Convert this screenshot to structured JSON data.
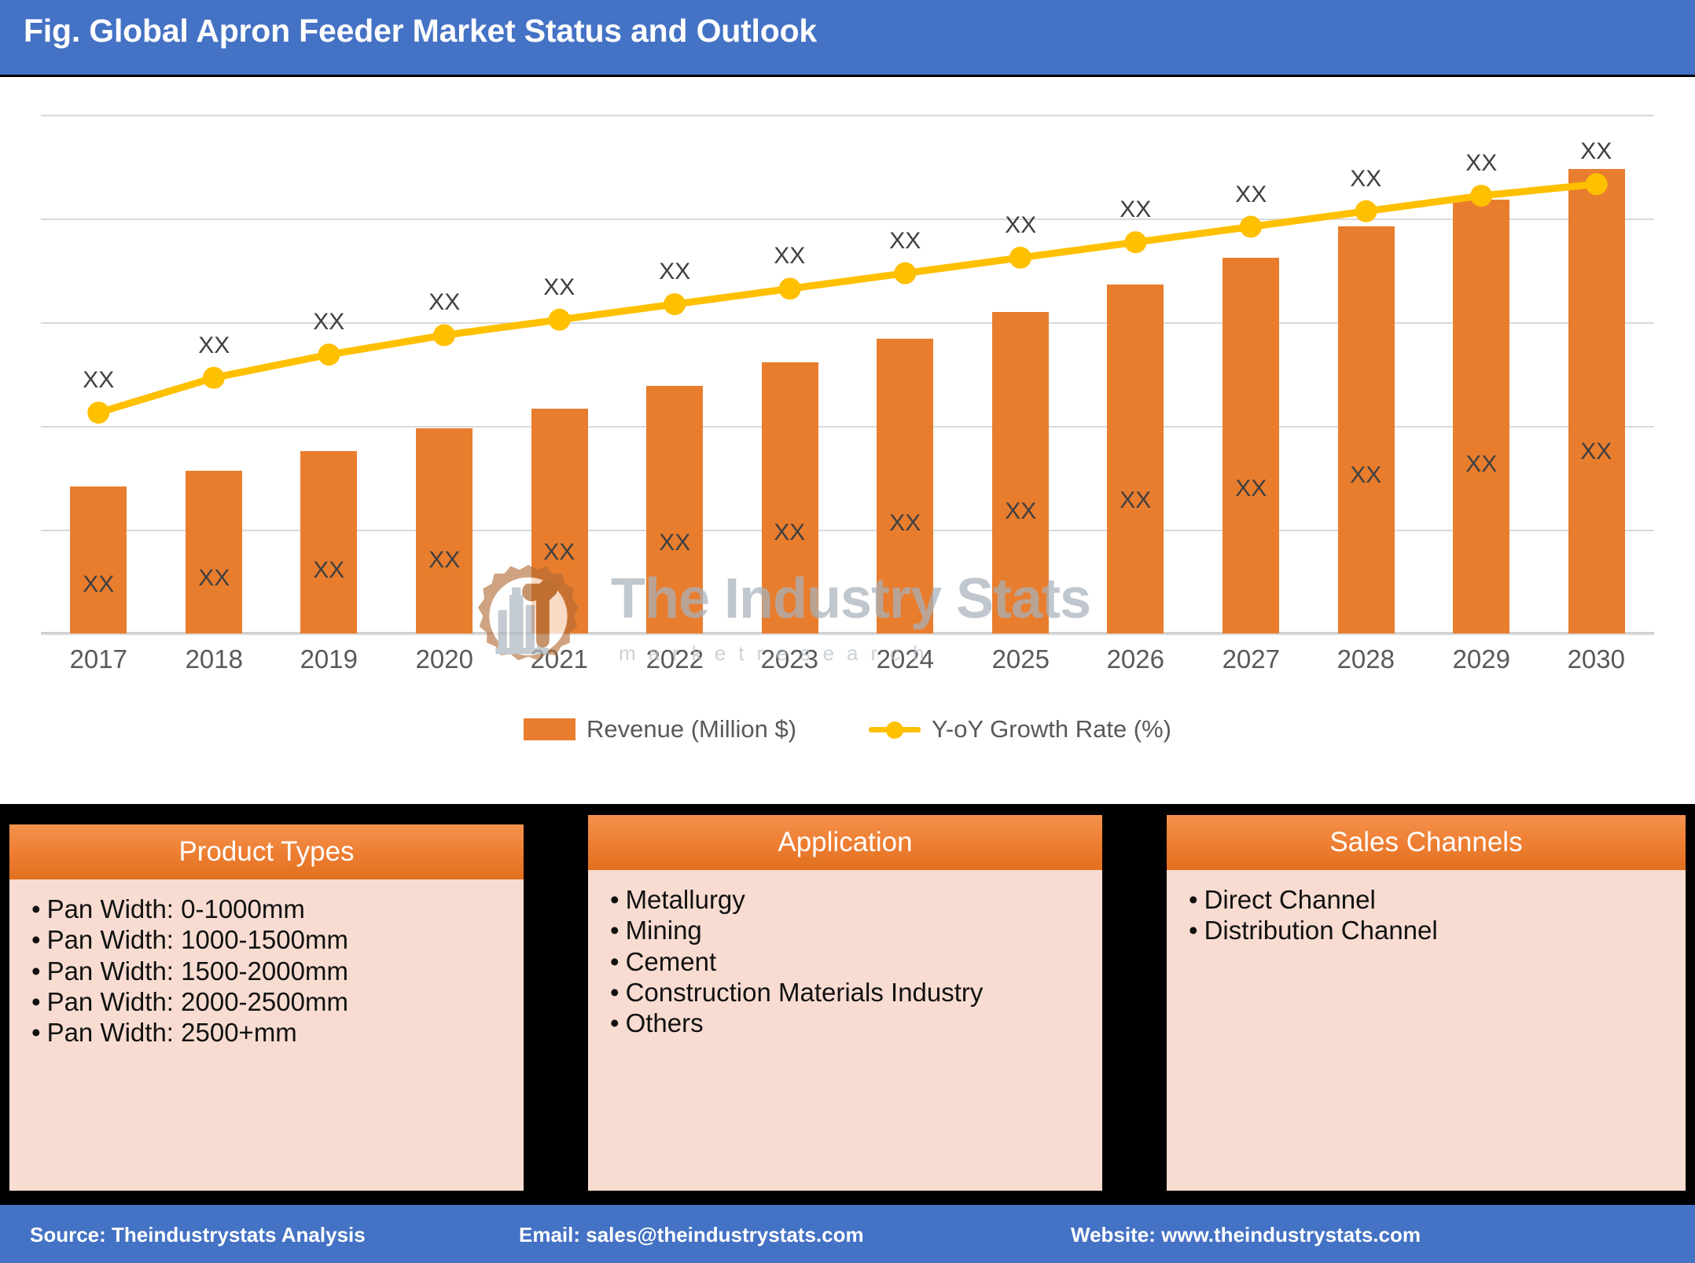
{
  "header": {
    "title": "Fig. Global Apron Feeder Market Status and Outlook",
    "background": "#4472C4"
  },
  "watermark": {
    "brand": "The Industry Stats",
    "tagline": "m a r k e t   r e s e a r c h",
    "logo_icon": "gear-factory-wrench-icon"
  },
  "chart_data": {
    "type": "bar",
    "title": "Global Apron Feeder Market Status and Outlook",
    "xlabel": "",
    "ylabel": "",
    "grid": true,
    "legend_position": "bottom",
    "categories": [
      "2017",
      "2018",
      "2019",
      "2020",
      "2021",
      "2022",
      "2023",
      "2024",
      "2025",
      "2026",
      "2027",
      "2028",
      "2029",
      "2030"
    ],
    "series": [
      {
        "name": "Revenue (Million $)",
        "type": "bar",
        "color": "#E87D2E",
        "axis": "left",
        "value_label": "XX",
        "values": [
          38,
          42,
          47,
          53,
          58,
          64,
          70,
          76,
          83,
          90,
          97,
          105,
          112,
          120
        ],
        "labels": [
          "XX",
          "XX",
          "XX",
          "XX",
          "XX",
          "XX",
          "XX",
          "XX",
          "XX",
          "XX",
          "XX",
          "XX",
          "XX",
          "XX"
        ]
      },
      {
        "name": "Y-oY Growth Rate (%)",
        "type": "line",
        "color": "#FFC000",
        "axis": "right",
        "value_label": "XX",
        "values": [
          57,
          66,
          72,
          77,
          81,
          85,
          89,
          93,
          97,
          101,
          105,
          109,
          113,
          116
        ],
        "labels": [
          "XX",
          "XX",
          "XX",
          "XX",
          "XX",
          "XX",
          "XX",
          "XX",
          "XX",
          "XX",
          "XX",
          "XX",
          "XX",
          "XX"
        ]
      }
    ],
    "ylim": [
      0,
      140
    ],
    "gridline_count": 6
  },
  "legend": [
    {
      "label": "Revenue (Million $)",
      "marker": "bar-swatch",
      "color": "#E87D2E"
    },
    {
      "label": "Y-oY Growth Rate (%)",
      "marker": "line-marker-swatch",
      "color": "#FFC000"
    }
  ],
  "panels": [
    {
      "title": "Product Types",
      "items": [
        "Pan Width: 0-1000mm",
        "Pan Width: 1000-1500mm",
        "Pan Width: 1500-2000mm",
        "Pan Width: 2000-2500mm",
        "Pan Width: 2500+mm"
      ]
    },
    {
      "title": "Application",
      "items": [
        "Metallurgy",
        "Mining",
        "Cement",
        "Construction Materials Industry",
        "Others"
      ]
    },
    {
      "title": "Sales Channels",
      "items": [
        "Direct Channel",
        "Distribution Channel"
      ]
    }
  ],
  "footer": {
    "source": "Source: Theindustrystats Analysis",
    "email": "Email: sales@theindustrystats.com",
    "website": "Website: www.theindustrystats.com",
    "background": "#4472C4"
  }
}
